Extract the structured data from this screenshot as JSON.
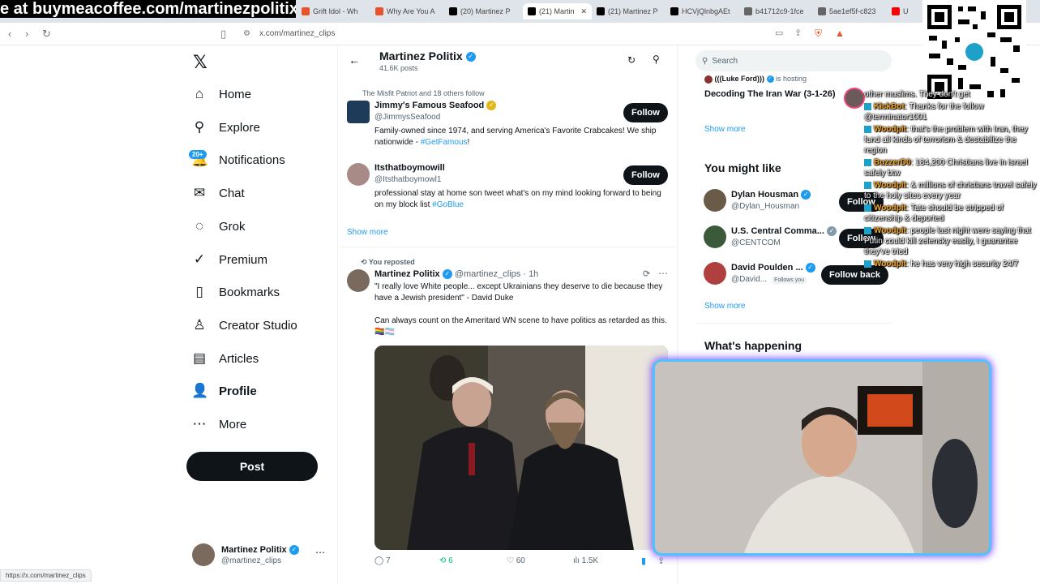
{
  "browser": {
    "banner_text": "e at buymeacoffee.com/martinezpolitix",
    "tabs": [
      {
        "label": "Grift Idol - Wh",
        "color": "#e8542a"
      },
      {
        "label": "Why Are You A",
        "color": "#e8542a"
      },
      {
        "label": "(20) Martinez P",
        "color": "#000000"
      },
      {
        "label": "(21) Martin",
        "color": "#000000",
        "active": true
      },
      {
        "label": "(21) Martinez P",
        "color": "#000000"
      },
      {
        "label": "HCVjQlnbgAEt",
        "color": "#000000"
      },
      {
        "label": "b41712c9-1fce",
        "color": "#666666"
      },
      {
        "label": "5ae1ef5f-c823",
        "color": "#666666"
      },
      {
        "label": "U",
        "color": "#ff0000"
      }
    ],
    "url": "x.com/martinez_clips",
    "status_url": "https://x.com/martinez_clips"
  },
  "nav": {
    "items": [
      {
        "label": "Home",
        "icon": "home-icon",
        "glyph": "⌂"
      },
      {
        "label": "Explore",
        "icon": "search-icon",
        "glyph": "⚲"
      },
      {
        "label": "Notifications",
        "icon": "bell-icon",
        "glyph": "🔔"
      },
      {
        "label": "Chat",
        "icon": "mail-icon",
        "glyph": "✉"
      },
      {
        "label": "Grok",
        "icon": "grok-icon",
        "glyph": "◌"
      },
      {
        "label": "Premium",
        "icon": "premium-icon",
        "glyph": "✓"
      },
      {
        "label": "Bookmarks",
        "icon": "bookmark-icon",
        "glyph": "▯"
      },
      {
        "label": "Creator Studio",
        "icon": "creator-icon",
        "glyph": "♙"
      },
      {
        "label": "Articles",
        "icon": "articles-icon",
        "glyph": "▤"
      },
      {
        "label": "Profile",
        "icon": "profile-icon",
        "glyph": "👤"
      },
      {
        "label": "More",
        "icon": "more-icon",
        "glyph": "⋯"
      }
    ],
    "notif_badge": "20+",
    "post_label": "Post",
    "account": {
      "name": "Martinez Politix",
      "handle": "@martinez_clips"
    }
  },
  "header": {
    "title": "Martinez Politix",
    "posts": "41.6K posts"
  },
  "suggestions": {
    "context": "The Misfit Patriot and 18 others follow",
    "items": [
      {
        "name": "Jimmy's Famous Seafood",
        "handle": "@JimmysSeafood",
        "bio_pre": "Family-owned since 1974, and serving America's Favorite Crabcakes! We ship nationwide - ",
        "bio_link": "#GetFamous",
        "bio_post": "!",
        "follow": "Follow"
      },
      {
        "name": "Itsthatboymowill",
        "handle": "@Itsthatboymowl1",
        "bio_pre": "professional stay at home son tweet what's on my mind looking forward to being on my block list ",
        "bio_link": "#GoBlue",
        "bio_post": "",
        "follow": "Follow"
      }
    ],
    "show_more": "Show more"
  },
  "tweet": {
    "repost_label": "You reposted",
    "name": "Martinez Politix",
    "handle": "@martinez_clips",
    "time": "· 1h",
    "quote": "\"I really love White people... except Ukrainians they deserve to die because they have a Jewish president\" - David Duke",
    "body": "Can always count on the Ameritard WN scene to have politics as retarded as this. 🏳️‍🌈🏳️‍⚧️",
    "stats": {
      "replies": "7",
      "reposts": "6",
      "likes": "60",
      "views": "1.5K"
    }
  },
  "right": {
    "search_placeholder": "Search",
    "space": {
      "host": "(((Luke Ford)))",
      "hosting": "is hosting",
      "title": "Decoding The Iran War (3-1-26)"
    },
    "show_more": "Show more",
    "you_might_like": "You might like",
    "people": [
      {
        "name": "Dylan Housman",
        "handle": "@Dylan_Housman",
        "button": "Follow",
        "badge": "blue"
      },
      {
        "name": "U.S. Central Comma...",
        "handle": "@CENTCOM",
        "button": "Follow",
        "badge": "gray"
      },
      {
        "name": "David Poulden ...",
        "handle": "@David...",
        "follows_you": "Follows you",
        "button": "Follow back",
        "badge": "blue"
      }
    ],
    "whats_happening": "What's happening"
  },
  "chat": [
    {
      "user": "",
      "text": "other muslims. They don't get"
    },
    {
      "user": "KickBot",
      "text": ": Thanks for the follow @terminator1001"
    },
    {
      "user": "Woodpit",
      "text": ": that's the problem with Iran, they fund all kinds of terrorism & destabilize the region"
    },
    {
      "user": "BuzzerD0",
      "text": ": 184,200 Christians live in israel safely btw"
    },
    {
      "user": "Woodpit",
      "text": ": & millions of christians travel safely to the holy sites every year"
    },
    {
      "user": "Woodpit",
      "text": ": Tate should be stripped of citizenship & deported"
    },
    {
      "user": "Woodpit",
      "text": ": people last night were saying that Putin could kill zelensky easily, I guarantee they've tried"
    },
    {
      "user": "Woodpit",
      "text": ": he has very high security 24/7"
    }
  ],
  "colors": {
    "accent": "#1d9bf0",
    "repost_green": "#00ba7c",
    "chat_user": "#f5a623"
  }
}
